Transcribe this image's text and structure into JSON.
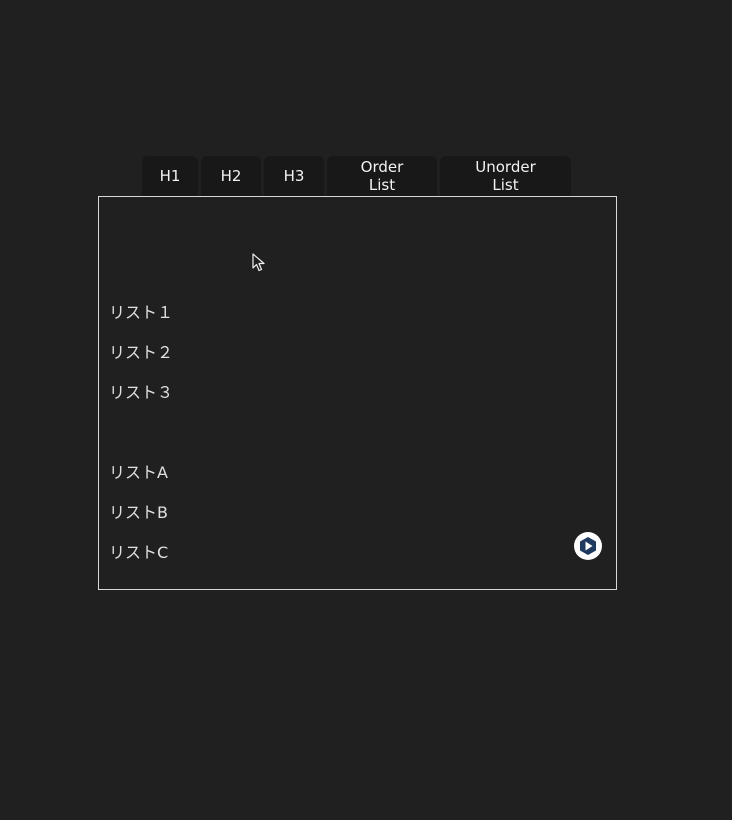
{
  "toolbar": {
    "buttons": [
      {
        "label": "H1"
      },
      {
        "label": "H2"
      },
      {
        "label": "H3"
      },
      {
        "label": "Order List"
      },
      {
        "label": "Unorder List"
      }
    ]
  },
  "editor": {
    "ordered_list": [
      "リスト１",
      "リスト２",
      "リスト３"
    ],
    "unordered_list": [
      "リストA",
      "リストB",
      "リストC"
    ]
  },
  "colors": {
    "background": "#202020",
    "toolbar_button": "#181818",
    "editor_border": "#d8d8d8",
    "fab_icon": "#1f3a5f"
  },
  "icons": {
    "cursor": "mouse-pointer-icon",
    "fab": "play-hexagon-icon"
  }
}
